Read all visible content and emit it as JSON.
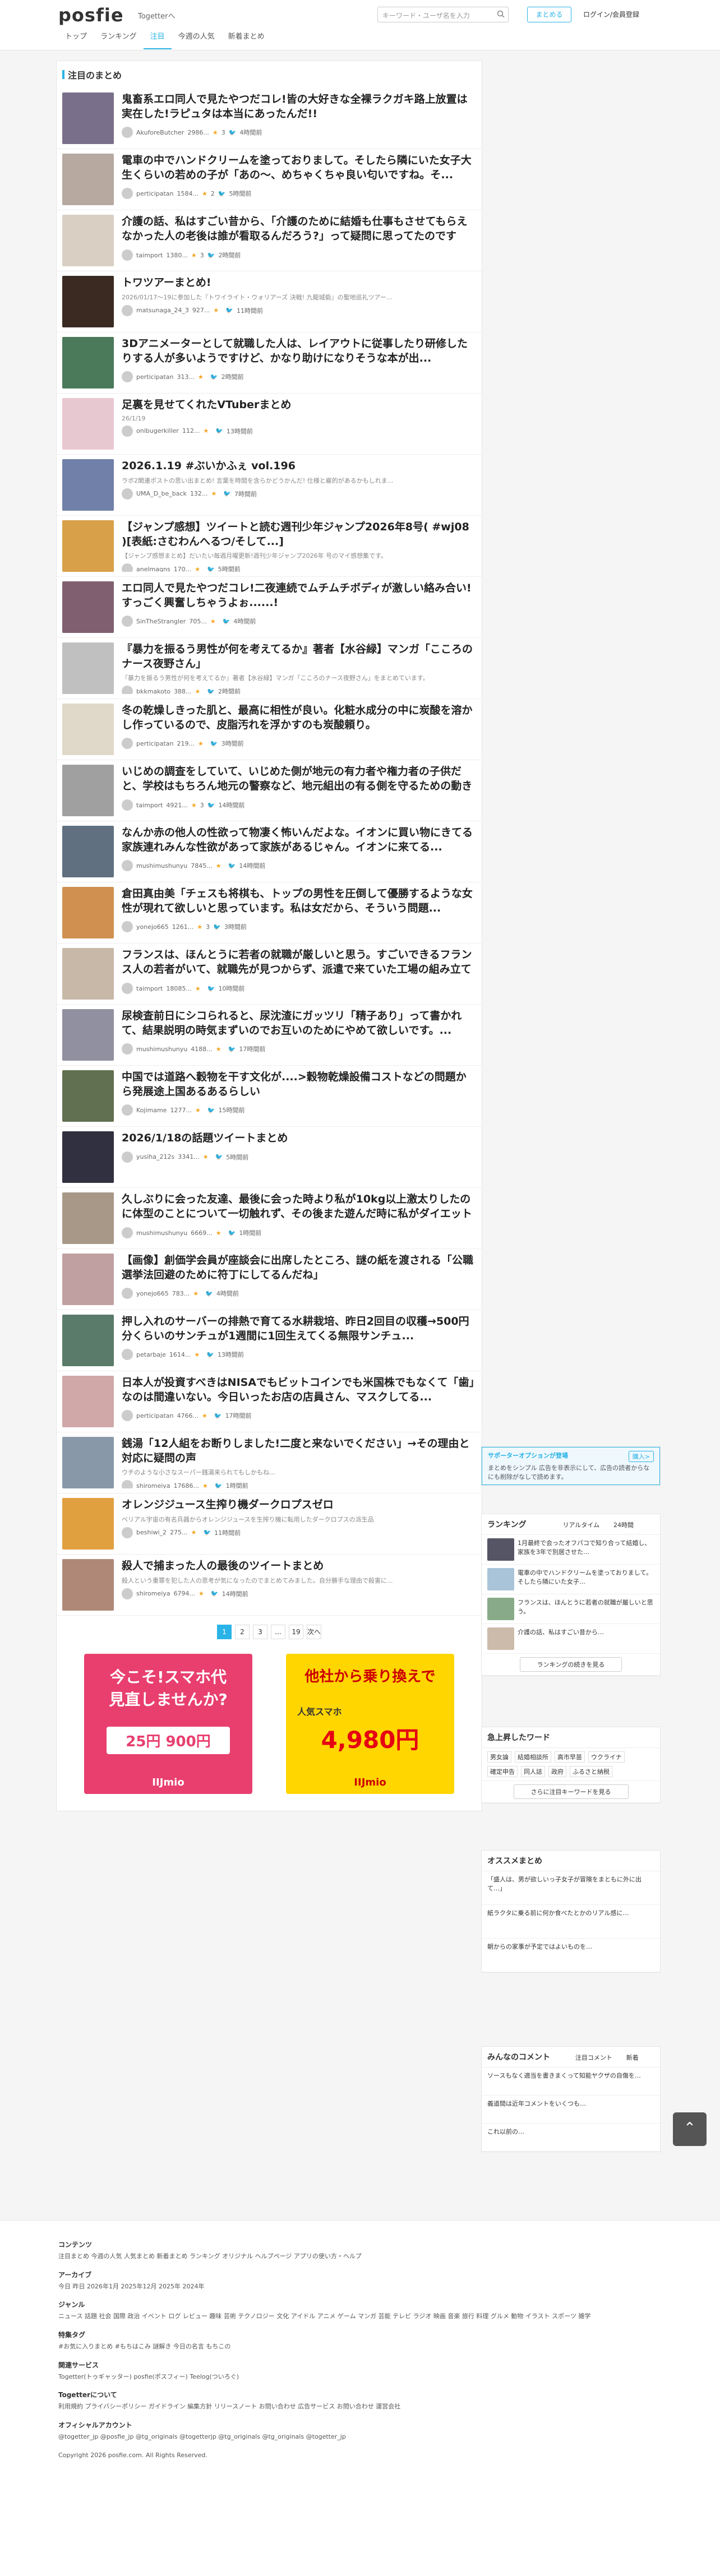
{
  "header": {
    "logo": "posfie",
    "togetter_link": "Togetterへ",
    "search_placeholder": "キーワード・ユーザ名を入力",
    "post_button": "まとめる",
    "login": "ログイン/会員登録",
    "nav": [
      "トップ",
      "ランキング",
      "注目",
      "今週の人気",
      "新着まとめ"
    ]
  },
  "main": {
    "section_title": "注目のまとめ",
    "items": [
      {
        "title": "鬼畜系エロ同人で見たやつだコレ!皆の大好きな全裸ラクガキ路上放置は実在した!ラピュタは本当にあったんだ!!",
        "desc": "",
        "user": "AkuforeButcher",
        "views": "2986...",
        "stars": "3",
        "time": "4時間前"
      },
      {
        "title": "電車の中でハンドクリームを塗っておりまして。そしたら隣にいた女子大生くらいの若めの子が「あの～、めちゃくちゃ良い匂いですね。そ...",
        "desc": "",
        "user": "perticipatan",
        "views": "1584...",
        "stars": "2",
        "time": "5時間前"
      },
      {
        "title": "介護の話、私はすごい昔から、「介護のために結婚も仕事もさせてもらえなかった人の老後は誰が看取るんだろう?」って疑問に思ってたのですが、現実は予想以...",
        "desc": "",
        "user": "taimport",
        "views": "1380...",
        "stars": "3",
        "time": "2時間前"
      },
      {
        "title": "トワツアーまとめ!",
        "desc": "2026/01/17〜19に参加した『トワイライト・ウォリアーズ 決戦! 九龍城砦』の聖地巡礼ツアー...",
        "user": "matsunaga_24_3",
        "views": "927...",
        "stars": "",
        "time": "11時間前"
      },
      {
        "title": "3Dアニメーターとして就職した人は、レイアウトに従事したり研修したりする人が多いようですけど、かなり助けになりそうな本が出...",
        "desc": "",
        "user": "perticipatan",
        "views": "313...",
        "stars": "",
        "time": "2時間前"
      },
      {
        "title": "足裏を見せてくれたVTuberまとめ",
        "desc": "26/1/19",
        "user": "onibugerkiller",
        "views": "112...",
        "stars": "",
        "time": "13時間前"
      },
      {
        "title": "2026.1.19 #ぶいかふぇ vol.196",
        "desc": "ラボ2関連ポストの思い出まとめ! 言葉を時間を含らかどうかんだ! 仕様と雇的があるかもしれま...",
        "user": "UMA_D_be_back",
        "views": "132...",
        "stars": "",
        "time": "7時間前"
      },
      {
        "title": "【ジャンプ感想】ツイートと読む週刊少年ジャンプ2026年8号( #wj08 )[表紙:さむわんへるつ/そして...]",
        "desc": "【ジャンプ感想まとめ】だいたい毎週月曜更新!週刊少年ジャンプ2026年 号のマイ感想集です。",
        "user": "anelmagns",
        "views": "170...",
        "stars": "",
        "time": "5時間前"
      },
      {
        "title": "エロ同人で見たやつだコレ!二夜連続でムチムチボディが激しい絡み合い!すっごく興奮しちゃうよぉ......!",
        "desc": "",
        "user": "SinTheStrangler",
        "views": "705...",
        "stars": "",
        "time": "4時間前"
      },
      {
        "title": "『暴力を振るう男性が何を考えてるか』著者【水谷緑】マンガ「こころのナース夜野さん」",
        "desc": "『暴力を振るう男性が何を考えてるか』著者【水谷緑】マンガ「こころのナース夜野さん」をまとめています。",
        "user": "bkkmakoto",
        "views": "388...",
        "stars": "",
        "time": "2時間前"
      },
      {
        "title": "冬の乾燥しきった肌と、最高に相性が良い。化粧水成分の中に炭酸を溶かし作っているので、皮脂汚れを浮かすのも炭酸頼り。",
        "desc": "",
        "user": "perticipatan",
        "views": "219...",
        "stars": "",
        "time": "3時間前"
      },
      {
        "title": "いじめの調査をしていて、いじめた側が地元の有力者や権力者の子供だと、学校はもちろん地元の警察など、地元組出の有る側を守るための動きが起こり、時...",
        "desc": "",
        "user": "taimport",
        "views": "4921...",
        "stars": "3",
        "time": "14時間前"
      },
      {
        "title": "なんか赤の他人の性欲って物凄く怖いんだよな。イオンに買い物にきてる家族連れみんな性欲があって家族があるじゃん。イオンに来てる...",
        "desc": "",
        "user": "mushimushunyu",
        "views": "7845...",
        "stars": "",
        "time": "14時間前"
      },
      {
        "title": "倉田真由美「チェスも将棋も、トップの男性を圧倒して優勝するような女性が現れて欲しいと思っています。私は女だから、そういう問題...",
        "desc": "",
        "user": "yonejo665",
        "views": "1261...",
        "stars": "3",
        "time": "3時間前"
      },
      {
        "title": "フランスは、ほんとうに若者の就職が厳しいと思う。すごいできるフランス人の若者がいて、就職先が見つからず、派遣で来ていた工場の組み立て作業の仕事で...",
        "desc": "",
        "user": "taimport",
        "views": "18085...",
        "stars": "",
        "time": "10時間前"
      },
      {
        "title": "尿検査前日にシコられると、尿沈渣にガッツリ「精子あり」って書かれて、結果説明の時気まずいのでお互いのためにやめて欲しいです。...",
        "desc": "",
        "user": "mushimushunyu",
        "views": "4188...",
        "stars": "",
        "time": "17時間前"
      },
      {
        "title": "中国では道路へ穀物を干す文化が....>穀物乾燥設備コストなどの問題から発展途上国あるあるらしい",
        "desc": "",
        "user": "Kojimame",
        "views": "1277...",
        "stars": "",
        "time": "15時間前"
      },
      {
        "title": "2026/1/18の話題ツイートまとめ",
        "desc": "",
        "user": "yusiha_212s",
        "views": "3341...",
        "stars": "",
        "time": "5時間前"
      },
      {
        "title": "久しぶりに会った友達、最後に会った時より私が10kg以上激太りしたのに体型のことについて一切触れず、その後また遊んだ時に私がダイエット成功して元の体...",
        "desc": "",
        "user": "mushimushunyu",
        "views": "6669...",
        "stars": "",
        "time": "1時間前"
      },
      {
        "title": "【画像】創価学会員が座談会に出席したところ、謎の紙を渡される「公職選挙法回避のために符丁にしてるんだね」",
        "desc": "",
        "user": "yonejo665",
        "views": "783...",
        "stars": "",
        "time": "4時間前"
      },
      {
        "title": "押し入れのサーバーの排熱で育てる水耕栽培、昨日2回目の収穫→500円分くらいのサンチュが1週間に1回生えてくる無限サンチュ...",
        "desc": "",
        "user": "petarbaje",
        "views": "1614...",
        "stars": "",
        "time": "13時間前"
      },
      {
        "title": "日本人が投資すべきはNISAでもビットコインでも米国株でもなくて「歯」なのは間違いない。今日いったお店の店員さん、マスクしてる...",
        "desc": "",
        "user": "perticipatan",
        "views": "4766...",
        "stars": "",
        "time": "17時間前"
      },
      {
        "title": "銭湯「12人組をお断りしました!二度と来ないでください」→その理由と対応に疑問の声",
        "desc": "ウチのような小さなスーパー銭湯来られてもしかもね...",
        "user": "shiromeiya",
        "views": "17686...",
        "stars": "",
        "time": "1時間前"
      },
      {
        "title": "オレンジジュース生搾り機ダークロプスゼロ",
        "desc": "ベリアル宇宙の有名兵器からオレンジジュースを生搾り機に転用したダークロプスの派生品",
        "user": "beshiwi_2",
        "views": "275...",
        "stars": "",
        "time": "11時間前"
      },
      {
        "title": "殺人で捕まった人の最後のツイートまとめ",
        "desc": "殺人という重罪を犯した人の思考が気になったのでまとめてみました。自分勝手な理由で殺害に...",
        "user": "shiromeiya",
        "views": "6794...",
        "stars": "",
        "time": "14時間前"
      }
    ],
    "pager": [
      "1",
      "2",
      "3",
      "...",
      "19",
      "次へ"
    ],
    "ads": [
      {
        "line1": "今こそ!スマホ代",
        "line2": "見直しませんか?",
        "price": "25円 900円",
        "brand": "IIJmio"
      },
      {
        "line1": "他社から乗り換えで",
        "line2": "人気スマホ",
        "price": "4,980円",
        "brand": "IIJmio"
      }
    ]
  },
  "sidebar": {
    "supporter": {
      "title": "サポーターオプションが登場",
      "button": "購入>",
      "text": "まとめをシンプル 広告を非表示にして、広告の読者からなにも削除がなしで読めます。"
    },
    "ranking": {
      "title": "ランキング",
      "tabs": [
        "リアルタイム",
        "24時間"
      ],
      "items": [
        "1月最終で会ったオフパコで知り合って結婚し、家族を3年で別居させた…",
        "電車の中でハンドクリームを塗っておりまして。そしたら隣にいた女子…",
        "フランスは、ほんとうに若者の就職が厳しいと思う。",
        "介護の話、私はすごい昔から…"
      ],
      "more": "ランキングの続きを見る"
    },
    "keywords": {
      "title": "急上昇したワード",
      "words": [
        "男女論",
        "結婚相談所",
        "高市早苗",
        "ウクライナ",
        "確定申告",
        "同人誌",
        "政府",
        "ふるさと納税"
      ],
      "more": "さらに注目キーワードを見る"
    },
    "recommend": {
      "title": "オススメまとめ",
      "items": [
        "「盛人は、男が欲しいっ子女子が冒険をまともに外に出て…」",
        "紙ラクタに乗る前に何か食べたとかのリアル感に…",
        "朝からの家事が予定ではよいものを…"
      ]
    },
    "comments": {
      "title": "みんなのコメント",
      "tabs": [
        "注目コメント",
        "新着"
      ],
      "items": [
        "ソースもなく適当を書きまくって知能ヤクザの自傷を…",
        "義道間は近年コメントをいくつも…",
        "これ以前の…"
      ]
    }
  },
  "footer": {
    "sections": [
      {
        "title": "コンテンツ",
        "text": "注目まとめ 今週の人気 人気まとめ 新着まとめ ランキング オリジナル ヘルプページ アプリの使い方・ヘルプ"
      },
      {
        "title": "アーカイブ",
        "text": "今日 昨日 2026年1月 2025年12月 2025年 2024年"
      },
      {
        "title": "ジャンル",
        "text": "ニュース 話題 社会 国際 政治 イベント ログ レビュー 趣味 芸術 テクノロジー 文化 アイドル アニメ ゲーム マンガ 芸能 テレビ ラジオ 映画 音楽 旅行 料理 グルメ 動物 イラスト スポーツ 雑学"
      },
      {
        "title": "特集タグ",
        "text": "#お気に入りまとめ #もちはこみ 謎解き 今日の名言 もちこの"
      },
      {
        "title": "関連サービス",
        "text": "Togetter(トゥギャッター) posfie(ポスフィー) Teelog(ついろぐ)"
      },
      {
        "title": "Togetterについて",
        "text": "利用規約 プライバシーポリシー ガイドライン 編集方針 リリースノート お問い合わせ 広告サービス お問い合わせ 運営会社"
      },
      {
        "title": "オフィシャルアカウント",
        "text": "@togetter_jp @posfie_jp @tg_originals @togetterjp @tg_originals @tg_originals @togetter_jp"
      }
    ],
    "copyright": "Copyright 2026 posfie.com. All Rights Reserved."
  },
  "colors": {
    "accent": "#2ab3e6",
    "hot": "#e74c3c"
  }
}
